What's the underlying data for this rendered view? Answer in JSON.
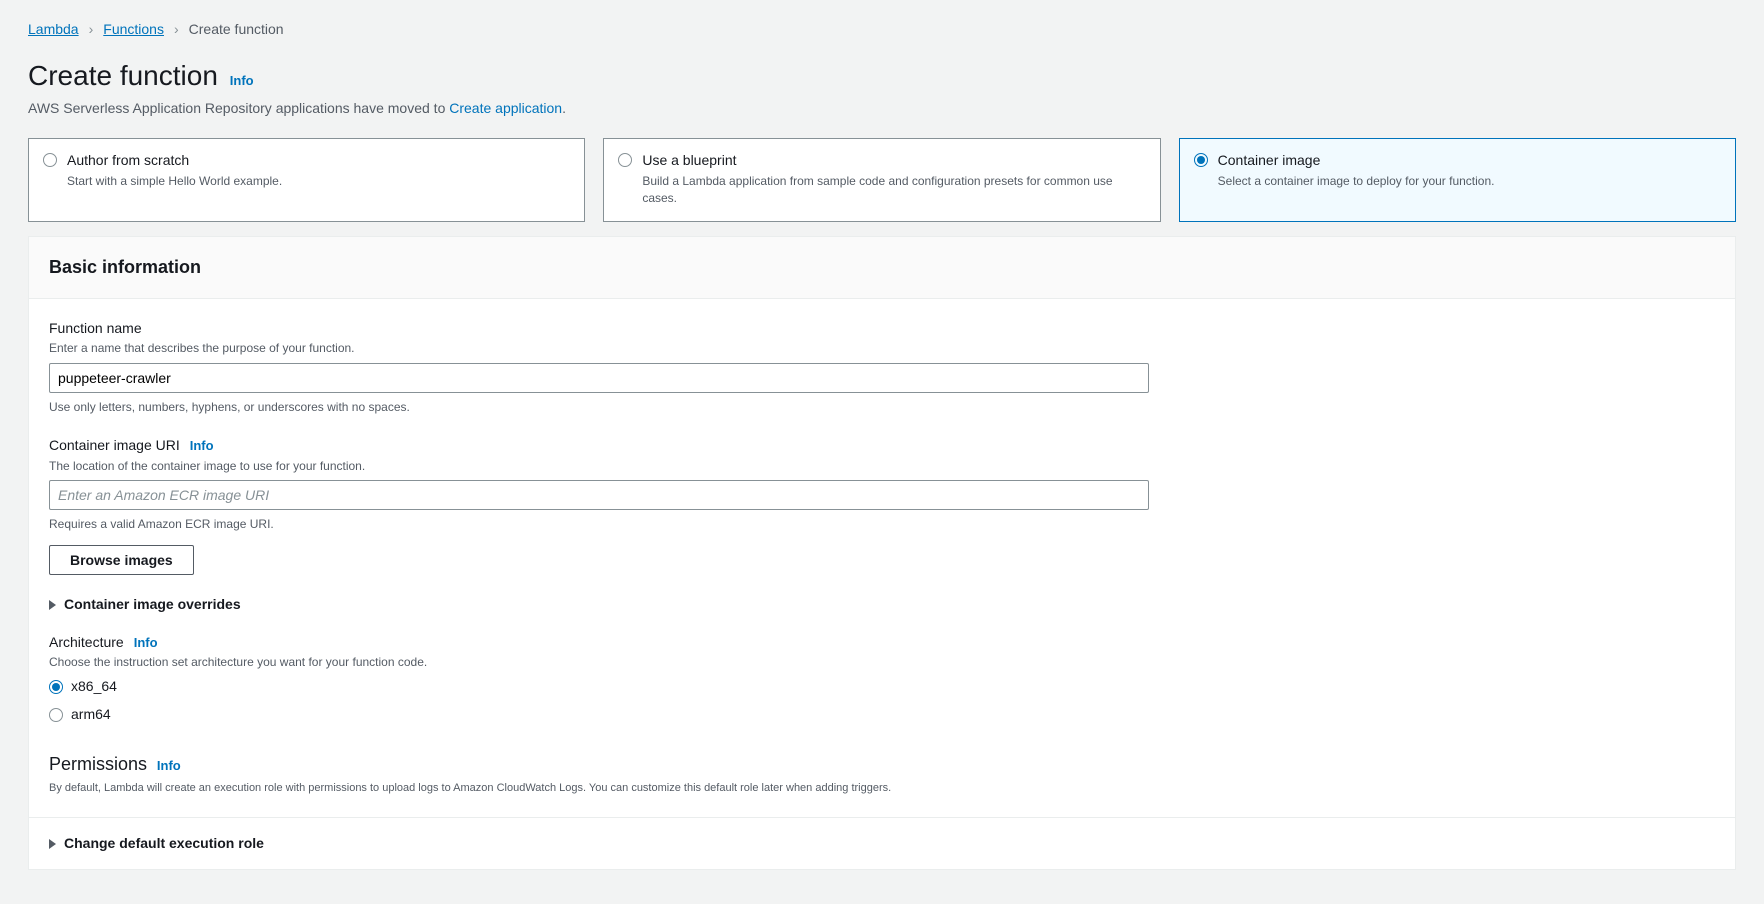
{
  "breadcrumb": {
    "lambda": "Lambda",
    "functions": "Functions",
    "current": "Create function"
  },
  "header": {
    "title": "Create function",
    "info": "Info",
    "subtext_prefix": "AWS Serverless Application Repository applications have moved to ",
    "subtext_link": "Create application",
    "subtext_suffix": "."
  },
  "tiles": [
    {
      "title": "Author from scratch",
      "desc": "Start with a simple Hello World example."
    },
    {
      "title": "Use a blueprint",
      "desc": "Build a Lambda application from sample code and configuration presets for common use cases."
    },
    {
      "title": "Container image",
      "desc": "Select a container image to deploy for your function."
    }
  ],
  "basic": {
    "heading": "Basic information",
    "fn_label": "Function name",
    "fn_desc": "Enter a name that describes the purpose of your function.",
    "fn_value": "puppeteer-crawler",
    "fn_hint": "Use only letters, numbers, hyphens, or underscores with no spaces.",
    "uri_label": "Container image URI",
    "uri_info": "Info",
    "uri_desc": "The location of the container image to use for your function.",
    "uri_placeholder": "Enter an Amazon ECR image URI",
    "uri_hint": "Requires a valid Amazon ECR image URI.",
    "browse_btn": "Browse images",
    "overrides": "Container image overrides",
    "arch_label": "Architecture",
    "arch_info": "Info",
    "arch_desc": "Choose the instruction set architecture you want for your function code.",
    "arch_options": [
      "x86_64",
      "arm64"
    ],
    "perm_heading": "Permissions",
    "perm_info": "Info",
    "perm_desc": "By default, Lambda will create an execution role with permissions to upload logs to Amazon CloudWatch Logs. You can customize this default role later when adding triggers.",
    "change_role": "Change default execution role"
  }
}
